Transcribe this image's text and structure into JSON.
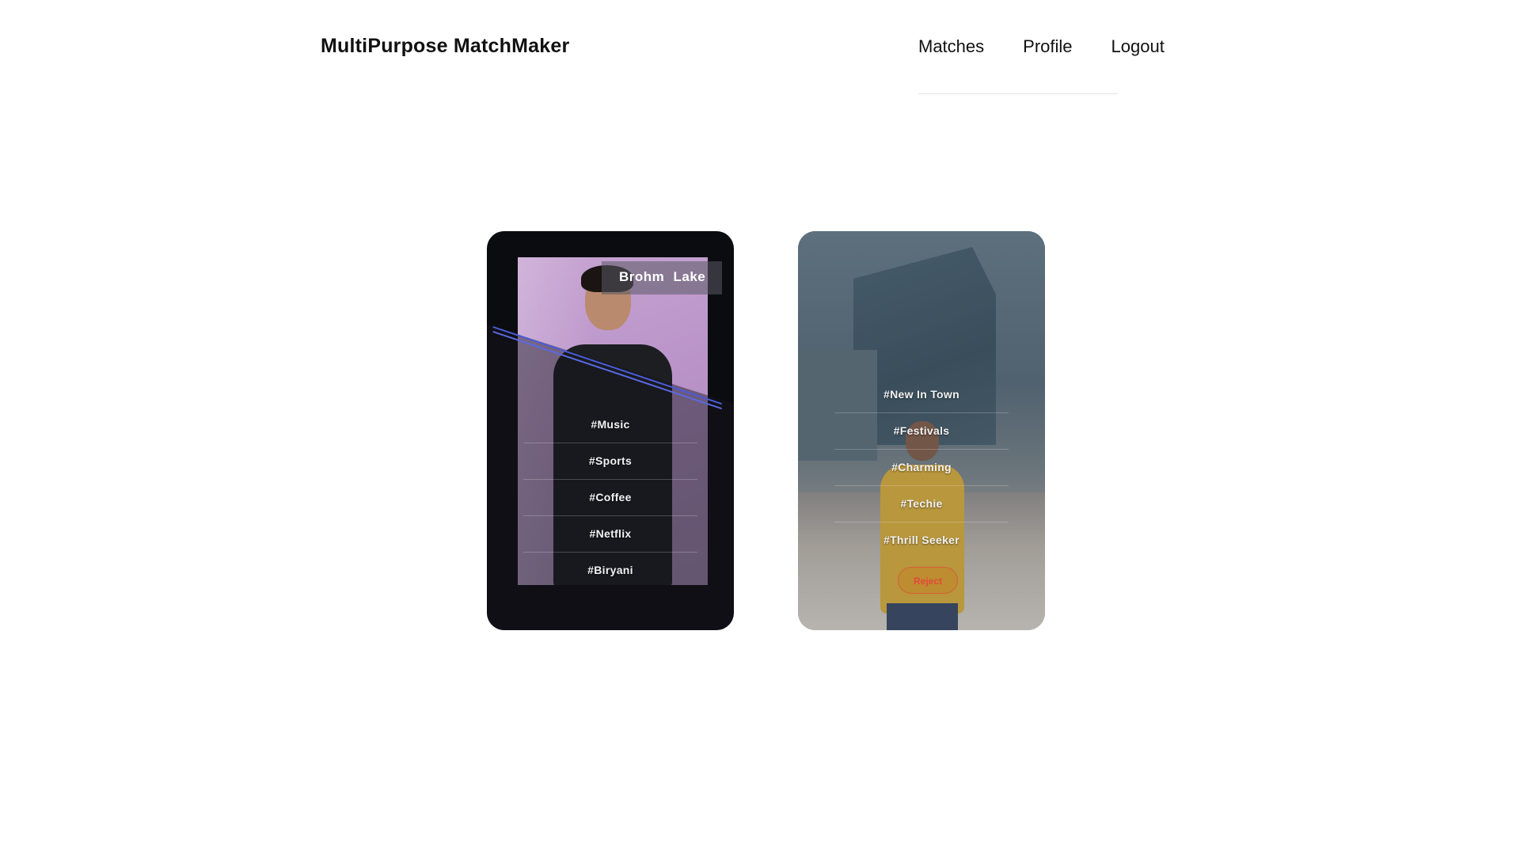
{
  "app": {
    "brand": "MultiPurpose MatchMaker"
  },
  "nav": {
    "items": [
      {
        "label": "Matches"
      },
      {
        "label": "Profile"
      },
      {
        "label": "Logout"
      }
    ]
  },
  "cards": [
    {
      "name": "Brohm  Lake",
      "tags": [
        "#Music",
        "#Sports",
        "#Coffee",
        "#Netflix",
        "#Biryani"
      ]
    },
    {
      "tags": [
        "#New In Town",
        "#Festivals",
        "#Charming",
        "#Techie",
        "#Thrill Seeker"
      ],
      "action_label": "Reject"
    }
  ]
}
